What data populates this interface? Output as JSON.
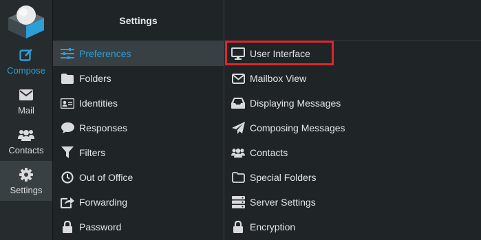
{
  "rail": {
    "items": [
      {
        "label": "Compose",
        "icon": "compose-icon"
      },
      {
        "label": "Mail",
        "icon": "mail-icon"
      },
      {
        "label": "Contacts",
        "icon": "contacts-icon"
      },
      {
        "label": "Settings",
        "icon": "gear-icon"
      }
    ],
    "active": "Settings"
  },
  "settings": {
    "title": "Settings",
    "active": "Preferences",
    "items": [
      {
        "label": "Preferences",
        "icon": "sliders-icon"
      },
      {
        "label": "Folders",
        "icon": "folder-icon"
      },
      {
        "label": "Identities",
        "icon": "id-card-icon"
      },
      {
        "label": "Responses",
        "icon": "comment-icon"
      },
      {
        "label": "Filters",
        "icon": "filter-icon"
      },
      {
        "label": "Out of Office",
        "icon": "clock-icon"
      },
      {
        "label": "Forwarding",
        "icon": "share-icon"
      },
      {
        "label": "Password",
        "icon": "lock-icon"
      }
    ]
  },
  "preferences": {
    "highlighted": "User Interface",
    "items": [
      {
        "label": "User Interface",
        "icon": "desktop-icon"
      },
      {
        "label": "Mailbox View",
        "icon": "envelope-icon"
      },
      {
        "label": "Displaying Messages",
        "icon": "inbox-icon"
      },
      {
        "label": "Composing Messages",
        "icon": "paper-plane-icon"
      },
      {
        "label": "Contacts",
        "icon": "users-icon"
      },
      {
        "label": "Special Folders",
        "icon": "folder-outline-icon"
      },
      {
        "label": "Server Settings",
        "icon": "server-icon"
      },
      {
        "label": "Encryption",
        "icon": "lock-icon"
      }
    ]
  },
  "colors": {
    "accent": "#2c9fd6",
    "highlight_border": "#e0262d",
    "background": "#1f2427"
  }
}
